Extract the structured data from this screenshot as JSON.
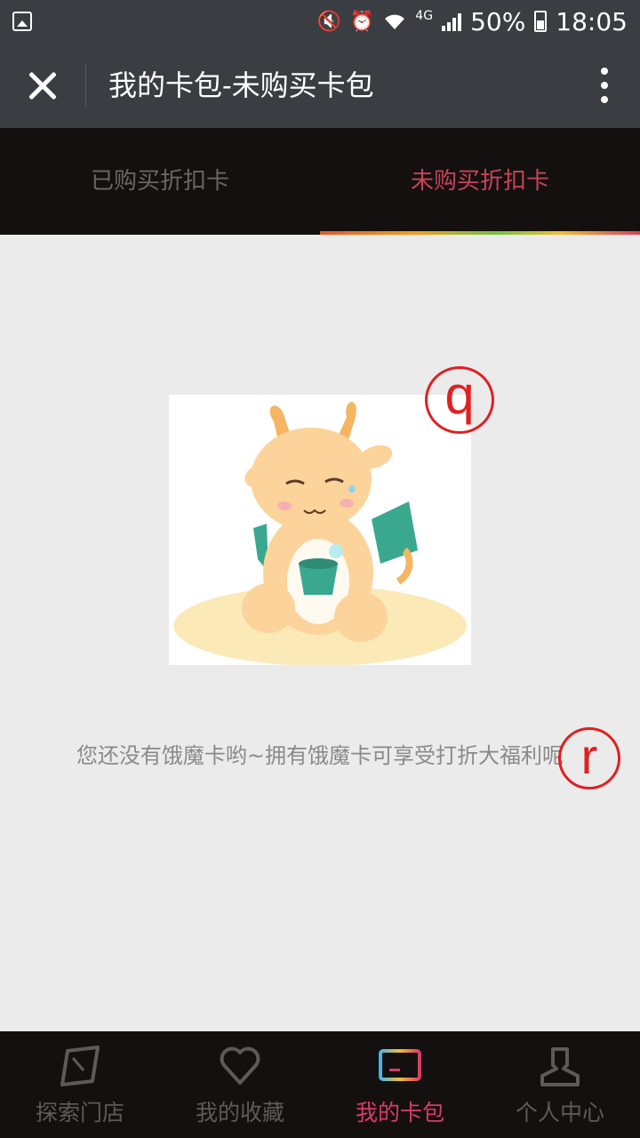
{
  "status_bar": {
    "network": "4G",
    "battery": "50%",
    "time": "18:05"
  },
  "header": {
    "title": "我的卡包-未购买卡包"
  },
  "tabs": [
    {
      "label": "已购买折扣卡",
      "active": false
    },
    {
      "label": "未购买折扣卡",
      "active": true
    }
  ],
  "content": {
    "empty_message": "您还没有饿魔卡哟~拥有饿魔卡可享受打折大福利呢",
    "markers": [
      "q",
      "r"
    ]
  },
  "bottom_nav": [
    {
      "label": "探索门店",
      "icon": "explore-icon",
      "active": false
    },
    {
      "label": "我的收藏",
      "icon": "heart-icon",
      "active": false
    },
    {
      "label": "我的卡包",
      "icon": "card-icon",
      "active": true
    },
    {
      "label": "个人中心",
      "icon": "person-icon",
      "active": false
    }
  ],
  "colors": {
    "accent": "#d93a6a",
    "header_bg": "#3a3d41",
    "tab_bg": "#141010"
  }
}
